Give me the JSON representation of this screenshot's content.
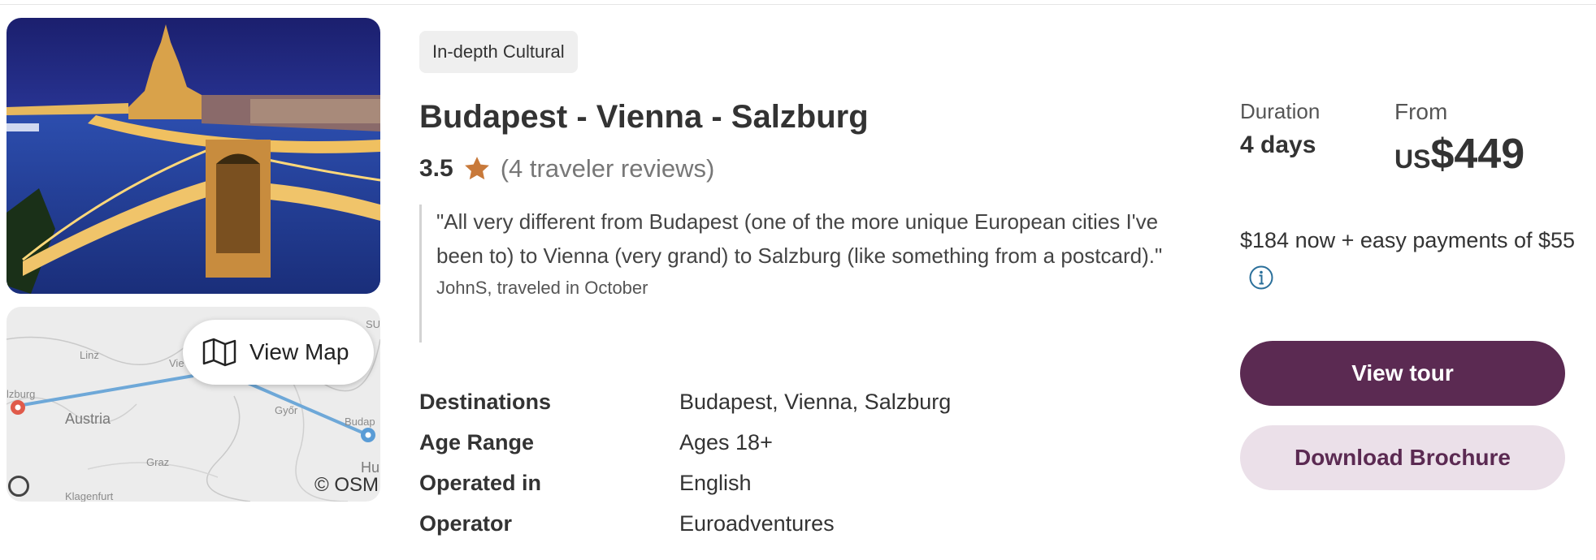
{
  "card": {
    "tag": "In-depth Cultural",
    "title": "Budapest - Vienna - Salzburg",
    "rating": "3.5",
    "reviews_text": "(4 traveler reviews)",
    "quote": "\"All very different from Budapest (one of the more unique European cities I've been to) to Vienna (very grand) to Salzburg (like something from a postcard).\"",
    "quote_author": "JohnS, traveled in October",
    "details": [
      {
        "label": "Destinations",
        "value": "Budapest, Vienna, Salzburg"
      },
      {
        "label": "Age Range",
        "value": "Ages 18+"
      },
      {
        "label": "Operated in",
        "value": "English"
      },
      {
        "label": "Operator",
        "value": "Euroadventures"
      }
    ]
  },
  "map": {
    "button_label": "View Map",
    "labels": {
      "linz": "Linz",
      "vienna": "Vie",
      "austria": "Austria",
      "graz": "Graz",
      "gyor": "Győr",
      "budapest": "Budap",
      "hu": "Hu",
      "klagenfurt": "Klagenfurt",
      "salzburg": "lzburg",
      "su": "SU"
    },
    "attribution": "© OSM"
  },
  "pricing": {
    "duration_label": "Duration",
    "duration_value": "4 days",
    "from_label": "From",
    "currency": "US",
    "price": "$449",
    "payments_text": "$184 now + easy payments of $55"
  },
  "actions": {
    "view_tour": "View tour",
    "download_brochure": "Download Brochure"
  },
  "colors": {
    "brand": "#5b2a52",
    "brand_light": "#ebe0e9",
    "star": "#c8793a",
    "route": "#6ea8d8",
    "info": "#2a6f9a"
  },
  "icons": {
    "star": "star-icon",
    "map": "map-icon",
    "info": "info-icon"
  }
}
